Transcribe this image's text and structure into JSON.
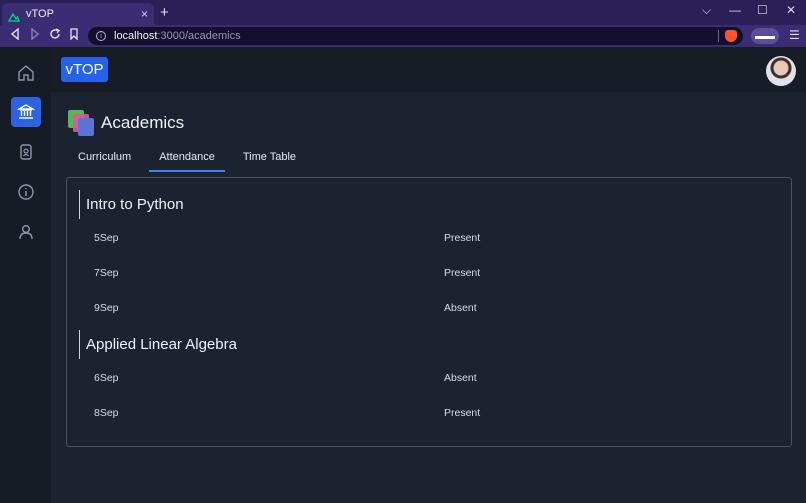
{
  "browser": {
    "tab_title": "vTOP",
    "tab_close": "×",
    "new_tab": "+",
    "url_host": "localhost",
    "url_path": ":3000/academics",
    "window_controls": [
      "⌵",
      "—",
      "☐",
      "✕"
    ]
  },
  "app": {
    "logo": "vTOP",
    "sidebar": {
      "items": [
        {
          "icon": "home-icon",
          "active": false
        },
        {
          "icon": "bank-icon",
          "active": true
        },
        {
          "icon": "id-badge-icon",
          "active": false
        },
        {
          "icon": "info-icon",
          "active": false
        },
        {
          "icon": "user-icon",
          "active": false
        }
      ]
    }
  },
  "page": {
    "title": "Academics",
    "tabs": [
      {
        "label": "Curriculum",
        "active": false
      },
      {
        "label": "Attendance",
        "active": true
      },
      {
        "label": "Time Table",
        "active": false
      }
    ],
    "courses": [
      {
        "name": "Intro to Python",
        "records": [
          {
            "date": "5Sep",
            "status": "Present"
          },
          {
            "date": "7Sep",
            "status": "Present"
          },
          {
            "date": "9Sep",
            "status": "Absent"
          }
        ]
      },
      {
        "name": "Applied Linear Algebra",
        "records": [
          {
            "date": "6Sep",
            "status": "Absent"
          },
          {
            "date": "8Sep",
            "status": "Present"
          }
        ]
      }
    ]
  },
  "colors": {
    "accent": "#2563eb",
    "background": "#1c2330",
    "browser_frame": "#3b2d73"
  }
}
